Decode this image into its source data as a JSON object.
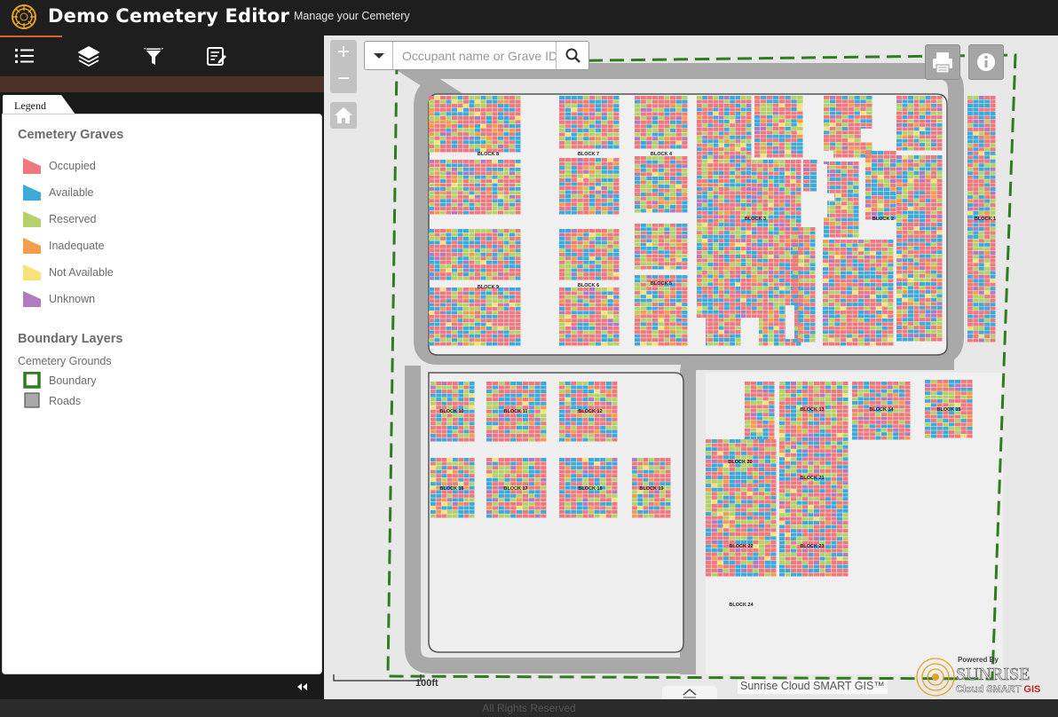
{
  "app": {
    "title": "Demo Cemetery Editor",
    "subtitle": "Manage your Cemetery"
  },
  "toolbar": {
    "items": [
      "list-icon",
      "layers-icon",
      "filter-icon",
      "edit-icon"
    ],
    "accent_color": "#d9622b"
  },
  "legend": {
    "tab_label": "Legend",
    "graves_title": "Cemetery Graves",
    "graves": [
      {
        "label": "Occupied",
        "color": "#ee7a80"
      },
      {
        "label": "Available",
        "color": "#3fa9d9"
      },
      {
        "label": "Reserved",
        "color": "#b5d16a"
      },
      {
        "label": "Inadequate",
        "color": "#f59c4e"
      },
      {
        "label": "Not Available",
        "color": "#f9e27a"
      },
      {
        "label": "Unknown",
        "color": "#b07cc0"
      }
    ],
    "boundary_title": "Boundary Layers",
    "grounds_label": "Cemetery Grounds",
    "boundary_items": [
      {
        "label": "Boundary",
        "color": "#2e7d1e"
      },
      {
        "label": "Roads",
        "color": "#a9a9a9"
      }
    ]
  },
  "search": {
    "placeholder": "Occupant name or Grave ID"
  },
  "map": {
    "zoom_in": "+",
    "zoom_out": "−",
    "scale_label": "100ft",
    "attribution": "Sunrise Cloud SMART GIS™",
    "powered_by": "Powered By",
    "brand_name": "SUNRISE",
    "brand_sub_a": "Cloud SMART ",
    "brand_sub_b": "GIS",
    "boundary_color": "#2e7d1e",
    "road_color": "#a9a9a9",
    "block_labels": [
      {
        "text": "BLOCK 8"
      },
      {
        "text": "BLOCK 7"
      },
      {
        "text": "BLOCK 4"
      },
      {
        "text": "BLOCK 3"
      },
      {
        "text": "BLOCK 2"
      },
      {
        "text": "BLOCK 1"
      },
      {
        "text": "BLOCK 9"
      },
      {
        "text": "BLOCK 6"
      },
      {
        "text": "BLOCK 5"
      },
      {
        "text": "BLOCK 10"
      },
      {
        "text": "BLOCK 11"
      },
      {
        "text": "BLOCK 12"
      },
      {
        "text": "BLOCK 13"
      },
      {
        "text": "BLOCK 14"
      },
      {
        "text": "BLOCK 15"
      },
      {
        "text": "BLOCK 16"
      },
      {
        "text": "BLOCK 17"
      },
      {
        "text": "BLOCK 18"
      },
      {
        "text": "BLOCK 19"
      },
      {
        "text": "BLOCK 20"
      },
      {
        "text": "BLOCK 21"
      },
      {
        "text": "BLOCK 22"
      },
      {
        "text": "BLOCK 23"
      },
      {
        "text": "BLOCK 24"
      }
    ]
  },
  "footer": {
    "text": "All Rights Reserved"
  }
}
